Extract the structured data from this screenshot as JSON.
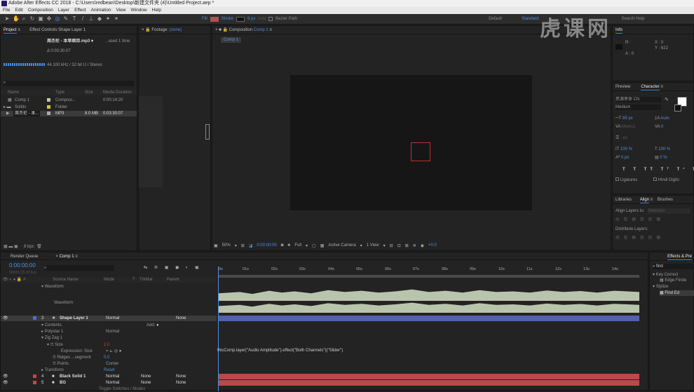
{
  "titlebar": {
    "title": "Adobe After Effects CC 2018 - C:\\Users\\redbean\\Desktop\\新建文件夹 (4)\\Untitled Project.aep *"
  },
  "menu": [
    "File",
    "Edit",
    "Composition",
    "Layer",
    "Effect",
    "Animation",
    "View",
    "Window",
    "Help"
  ],
  "toolbar": {
    "fill": "Fill",
    "stroke": "Stroke",
    "stroke_px": "6 px",
    "add": "Add",
    "bezier": "Bezier Path",
    "workspaces": [
      "Default",
      "Standard"
    ],
    "search": "Search Help"
  },
  "project": {
    "tab": "Project",
    "effect_tab": "Effect Controls Shape Layer 1",
    "file": "周杰伦 - 本草纲目.mp3 ▾",
    "used": ", used 1 time",
    "dur": "Δ 0:03:30:07",
    "audio": "44.100 kHz / 32 bit U / Stereo",
    "cols": [
      "Name",
      "Type",
      "Size",
      "Media Duration"
    ],
    "items": [
      {
        "name": "Comp 1",
        "type": "Composi...",
        "size": "",
        "dur": "0:00:14:20"
      },
      {
        "name": "Solids",
        "type": "Folder",
        "size": "",
        "dur": ""
      },
      {
        "name": "周杰伦 - 本...",
        "type": "MP3",
        "size": "8.0 MB",
        "dur": "0:03:30:07"
      }
    ],
    "bpc": "8 bpc"
  },
  "footage": {
    "tab": "Footage",
    "val": "(none)"
  },
  "comp": {
    "tab": "Composition",
    "name": "Comp 1",
    "crumb": "Comp 1",
    "zoom": "50%",
    "time": "0:00:00:00",
    "res": "Full",
    "cam": "Active Camera",
    "view": "1 View",
    "offset": "+0.0"
  },
  "info": {
    "tab": "Info",
    "r": "R :",
    "a": "A : 0",
    "x": "X : 0",
    "y": "Y : 622"
  },
  "character": {
    "preview": "Preview",
    "tab": "Character",
    "font": "思源黑体 CN",
    "style": "Medium",
    "size": "85 px",
    "lead": "Auto",
    "kern": "Metrics",
    "track": "0",
    "stroke": "- px",
    "vscale": "100 %",
    "hscale": "100 %",
    "base": "0 px",
    "tsume": "0 %",
    "ligatures": "Ligatures",
    "hindi": "Hindi Digits"
  },
  "align": {
    "libraries": "Libraries",
    "tab": "Align",
    "brushes": "Brushes",
    "to": "Align Layers to:",
    "to_val": "Selection",
    "dist": "Distribute Layers:"
  },
  "timeline": {
    "render": "Render Queue",
    "tab": "Comp 1",
    "time": "0:00:00:00",
    "frames": "00000 (25.00 fps)",
    "ticks": [
      "0s",
      "01s",
      "02s",
      "03s",
      "04s",
      "05s",
      "06s",
      "07s",
      "08s",
      "09s",
      "10s",
      "11s",
      "12s",
      "13s",
      "14s"
    ],
    "cols": [
      "Source Name",
      "Mode",
      "T",
      "TrkMat",
      "Parent"
    ],
    "rows": [
      {
        "indent": 0,
        "name": "Waveform",
        "mode": "",
        "parent": ""
      },
      {
        "indent": 0,
        "name": "Waveform",
        "mode": "",
        "parent": ""
      },
      {
        "indent": 0,
        "num": "3",
        "name": "Shape Layer 1",
        "mode": "Normal",
        "parent": "None"
      },
      {
        "indent": 1,
        "name": "Contents",
        "mode": "",
        "add": "Add:"
      },
      {
        "indent": 2,
        "name": "Polystar 1",
        "mode": "Normal"
      },
      {
        "indent": 2,
        "name": "Zig Zag 1",
        "mode": ""
      },
      {
        "indent": 3,
        "name": "Size",
        "val": "2.0"
      },
      {
        "indent": 4,
        "name": "Expression: Size",
        "val": ""
      },
      {
        "indent": 3,
        "name": "Ridges ...segment",
        "val": "0.0"
      },
      {
        "indent": 3,
        "name": "Points",
        "val": "Corner"
      },
      {
        "indent": 1,
        "name": "Transform",
        "val": "Reset"
      },
      {
        "indent": 0,
        "num": "4",
        "name": "Black Solid 1",
        "mode": "Normal",
        "trk": "None",
        "parent": "None"
      },
      {
        "indent": 0,
        "num": "5",
        "name": "BG",
        "mode": "Normal",
        "trk": "None",
        "parent": "None"
      }
    ],
    "expression": "thisComp.layer(\"Audio Amplitude\").effect(\"Both Channels\")(\"Slider\")",
    "footer": "Toggle Switches / Modes"
  },
  "effects": {
    "tab": "Effects & Pre",
    "search": "find",
    "tree": [
      "Key Correct",
      "Edge Finde",
      "Stylize",
      "Find Ed"
    ]
  },
  "watermark": "虎课网"
}
